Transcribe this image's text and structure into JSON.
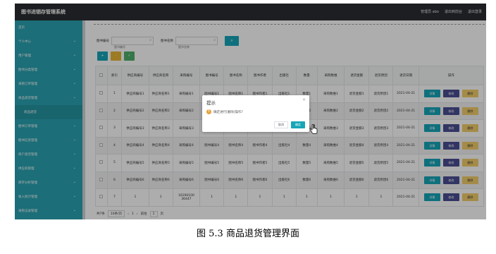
{
  "app": {
    "title": "图书进销存管理系统"
  },
  "topnav": [
    "管理员 abo",
    "退出到前台",
    "退出登录"
  ],
  "sidebar": [
    {
      "label": "首页",
      "chevron": false
    },
    {
      "label": "个人中心",
      "chevron": true
    },
    {
      "label": "用户管理",
      "chevron": true
    },
    {
      "label": "图书分类管理",
      "chevron": true
    },
    {
      "label": "采购订单管理",
      "chevron": true
    },
    {
      "label": "商品退货管理",
      "chevron": true
    },
    {
      "label": "商品退货",
      "chevron": false,
      "sub": true
    },
    {
      "label": "图书订单管理",
      "chevron": true
    },
    {
      "label": "图书信息管理",
      "chevron": true
    },
    {
      "label": "商户退货管理",
      "chevron": true
    },
    {
      "label": "供应商管理",
      "chevron": true
    },
    {
      "label": "库存分析管理",
      "chevron": true
    },
    {
      "label": "收入统计管理",
      "chevron": true
    },
    {
      "label": "采购记录管理",
      "chevron": true
    }
  ],
  "search": {
    "label1": "图书编号",
    "placeholder1": "图书编号",
    "label2": "图书名称",
    "placeholder2": "图书名称",
    "button_icon": "search-icon"
  },
  "actions": [
    {
      "label": "+",
      "color": "#17a6b8"
    },
    {
      "label": "-",
      "color": "#e8b534"
    },
    {
      "label": "✓",
      "color": "#4fb06c"
    }
  ],
  "table": {
    "headers": [
      "",
      "索引",
      "供应商编号",
      "供应商名称",
      "采购编号",
      "图书编号",
      "图书名称",
      "图书作者",
      "出版社",
      "数量",
      "采购数维",
      "退货金额",
      "退货原因",
      "退货日期",
      "操作"
    ],
    "rows": [
      [
        "",
        "1",
        "供应商编号1",
        "供应商名称1",
        "采购编号1",
        "图书编号1",
        "图书名称1",
        "图书作者1",
        "出版社1",
        "数量1",
        "采购数维1",
        "退货金额1",
        "退货原因1",
        "2021-04-21"
      ],
      [
        "",
        "2",
        "供应商编号2",
        "供应商名称2",
        "采购编号2",
        "图书编号2",
        "图书名称2",
        "图书作者2",
        "出版社2",
        "数量2",
        "采购数维2",
        "退货金额2",
        "退货原因2",
        "2021-04-21"
      ],
      [
        "",
        "3",
        "供应商编号3",
        "供应商名称3",
        "采购编号3",
        "图书编号3",
        "图书名称3",
        "图书作者3",
        "出版社3",
        "数量3",
        "采购数维3",
        "退货金额3",
        "退货原因3",
        "2021-04-21"
      ],
      [
        "",
        "4",
        "供应商编号4",
        "供应商名称4",
        "采购编号4",
        "图书编号4",
        "图书名称4",
        "图书作者4",
        "出版社4",
        "数量4",
        "采购数维4",
        "退货金额4",
        "退货原因4",
        "2021-04-21"
      ],
      [
        "",
        "5",
        "供应商编号5",
        "供应商名称5",
        "采购编号5",
        "图书编号5",
        "图书名称5",
        "图书作者5",
        "出版社5",
        "数量5",
        "采购数维5",
        "退货金额5",
        "退货原因5",
        "2021-04-21"
      ],
      [
        "",
        "6",
        "供应商编号6",
        "供应商名称6",
        "采购编号6",
        "图书编号6",
        "图书名称6",
        "图书作者6",
        "出版社6",
        "数量6",
        "采购数维6",
        "退货金额6",
        "退货原因6",
        "2021-04-21"
      ],
      [
        "",
        "7",
        "1",
        "1",
        "16190100 36447",
        "1",
        "1",
        "1",
        "1",
        "1",
        "1",
        "1",
        "1",
        "2021-04-21"
      ]
    ],
    "ops": {
      "detail": "详情",
      "edit": "修改",
      "delete": "删除"
    }
  },
  "pager": {
    "total": "共7条",
    "size": "10条/页",
    "prev": "‹",
    "page": "1",
    "next": "›",
    "goto": "前往",
    "goto_value": "1",
    "unit": "页"
  },
  "dialog": {
    "title": "提示",
    "message": "确定进行[删除]操作?",
    "cancel": "取消",
    "ok": "确定",
    "icon": "warning-icon"
  },
  "caption": "图 5.3  商品退货管理界面"
}
